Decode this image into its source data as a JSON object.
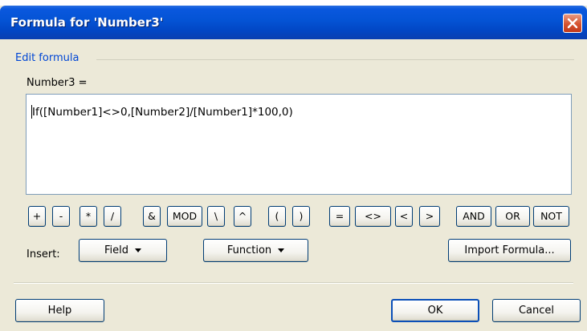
{
  "dialog": {
    "title": "Formula for 'Number3'"
  },
  "group": {
    "label": "Edit formula"
  },
  "field": {
    "label": "Number3 ="
  },
  "editor": {
    "formula": "If([Number1]<>0,[Number2]/[Number1]*100,0)"
  },
  "operators": {
    "plus": "+",
    "minus": "-",
    "mult": "*",
    "div": "/",
    "amp": "&",
    "mod": "MOD",
    "idiv": "\\",
    "pow": "^",
    "lparen": "(",
    "rparen": ")",
    "eq": "=",
    "ne": "<>",
    "lt": "<",
    "gt": ">",
    "and": "AND",
    "or": "OR",
    "not": "NOT"
  },
  "insert": {
    "label": "Insert:",
    "field_btn": "Field",
    "function_btn": "Function",
    "import_btn": "Import Formula..."
  },
  "footer": {
    "help": "Help",
    "ok": "OK",
    "cancel": "Cancel"
  }
}
